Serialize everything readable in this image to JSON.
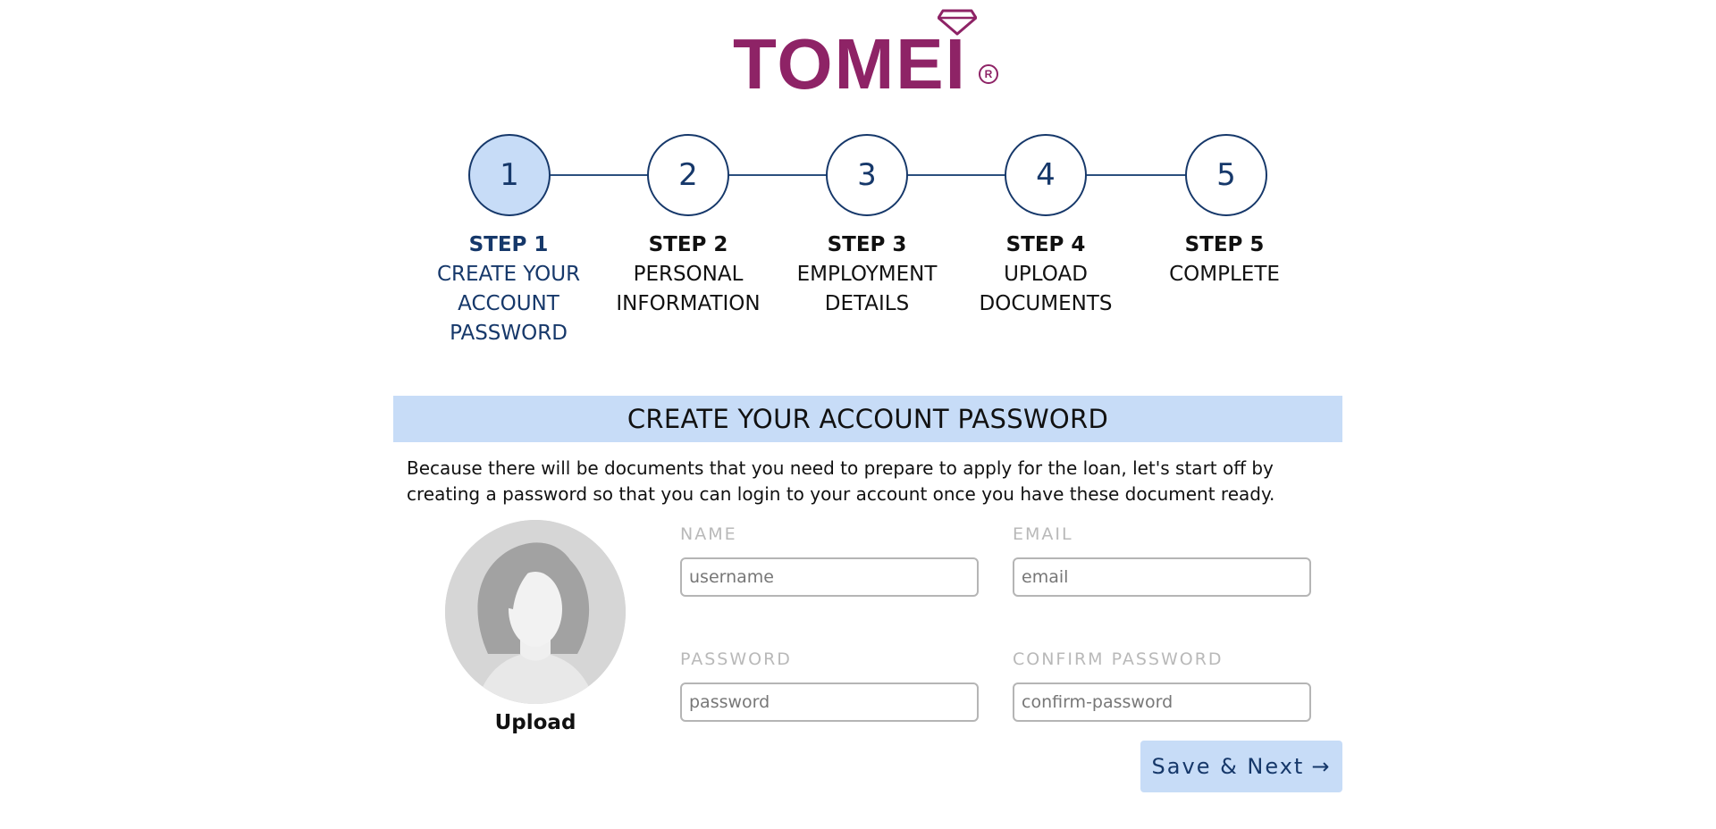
{
  "brand": {
    "name": "TOMEI",
    "registered_mark": "R",
    "color": "#8e2366"
  },
  "stepper": {
    "active_index": 0,
    "steps": [
      {
        "number": "1",
        "title": "STEP 1",
        "desc": "CREATE YOUR\nACCOUNT\nPASSWORD"
      },
      {
        "number": "2",
        "title": "STEP 2",
        "desc": "PERSONAL\nINFORMATION"
      },
      {
        "number": "3",
        "title": "STEP 3",
        "desc": "EMPLOYMENT\nDETAILS"
      },
      {
        "number": "4",
        "title": "STEP 4",
        "desc": "UPLOAD\nDOCUMENTS"
      },
      {
        "number": "5",
        "title": "STEP 5",
        "desc": "COMPLETE"
      }
    ]
  },
  "section": {
    "title": "CREATE YOUR ACCOUNT PASSWORD",
    "intro": "Because there will be documents that you need to prepare to apply for the loan, let's start off by creating a password so that you can login to your account once you have these document ready."
  },
  "avatar": {
    "upload_label": "Upload",
    "icon": "avatar-placeholder-icon"
  },
  "form": {
    "name": {
      "label": "NAME",
      "placeholder": "username",
      "value": ""
    },
    "email": {
      "label": "EMAIL",
      "placeholder": "email",
      "value": ""
    },
    "password": {
      "label": "PASSWORD",
      "placeholder": "password",
      "value": ""
    },
    "confirm_password": {
      "label": "CONFIRM PASSWORD",
      "placeholder": "confirm-password",
      "value": ""
    }
  },
  "actions": {
    "save_label": "Save & Next",
    "save_icon": "→"
  },
  "colors": {
    "accent": "#16386a",
    "accent_light": "#c7dcf7",
    "label_gray": "#b9b9b9"
  }
}
